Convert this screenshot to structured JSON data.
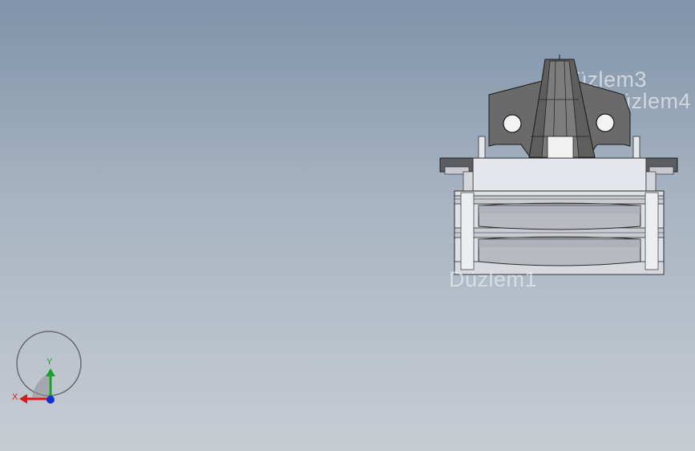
{
  "viewport": {
    "background_top": "#7f93aa",
    "background_bottom": "#c7ccd2"
  },
  "planes": {
    "plane3": "Düzlem3",
    "plane4": "Düzlem4",
    "plane1": "Düzlem1"
  },
  "triad": {
    "x_label": "X",
    "y_label": "Y",
    "x_color": "#d21c1c",
    "y_color": "#1aa02a",
    "z_color": "#1030d0"
  },
  "model": {
    "body_color": "#d6d8de",
    "bracket_color": "#6b6b6b"
  }
}
